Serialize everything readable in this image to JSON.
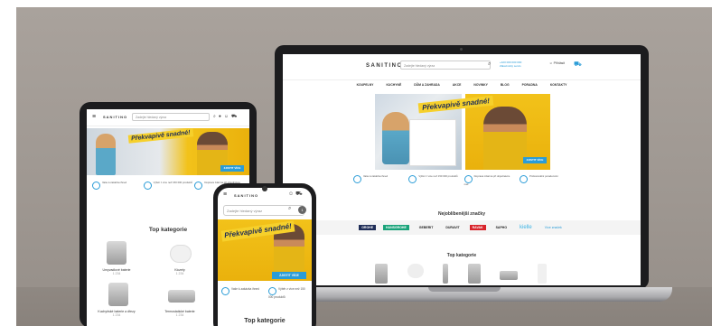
{
  "brand": "SANITINO",
  "search_placeholder": "Zadejte hledaný výraz",
  "hero": {
    "tagline": "Překvapivě snadné!",
    "cta_label": "ZJISTIT VÍCE"
  },
  "laptop": {
    "contact_phone": "+420 000 000 000",
    "contact_label": "Zákaznický servis",
    "account_label": "Přihlásit",
    "nav": [
      "KOUPELNY",
      "KUCHYNĚ",
      "DŮM A ZAHRADA",
      "AKCE",
      "NOVINKY",
      "BLOG",
      "PORADNA",
      "KONTAKTY"
    ],
    "features": [
      "Vaše k-zakázka ihned",
      "Výběr z více než 150 000 produktů",
      "Doprava zdarma při objednávce nad",
      "Profesionální poradenství"
    ],
    "brands_title": "Nejoblíbenější značky",
    "brands": [
      "GROHE",
      "HANSGROHE",
      "GEBERIT",
      "DURAVIT",
      "RAVAK",
      "SAPHO",
      "kielle",
      "Více značek"
    ],
    "topcat_title": "Top kategorie"
  },
  "tablet": {
    "features": [
      "Vaše k-zakázka ihned",
      "Výběr z více než 150 000 produktů",
      "Doprava zdarma při objednávce"
    ],
    "topcat_title": "Top kategorie",
    "categories": [
      {
        "name": "Umyvadlové baterie",
        "count": "1 234"
      },
      {
        "name": "Klozety",
        "count": "1 234"
      },
      {
        "name": "Kuchyňské baterie a dřezy",
        "count": "1 234"
      },
      {
        "name": "Termostatické baterie",
        "count": "1 234"
      }
    ]
  },
  "phone": {
    "search_badge": "1",
    "features": [
      "Vaše k-zakázka ihned",
      "Výběr z více než 150 000 produktů"
    ],
    "topcat_title": "Top kategorie"
  },
  "colors": {
    "accent": "#2a9cd7",
    "banner_yellow": "#f2c21a",
    "navy": "#1f2d57"
  }
}
